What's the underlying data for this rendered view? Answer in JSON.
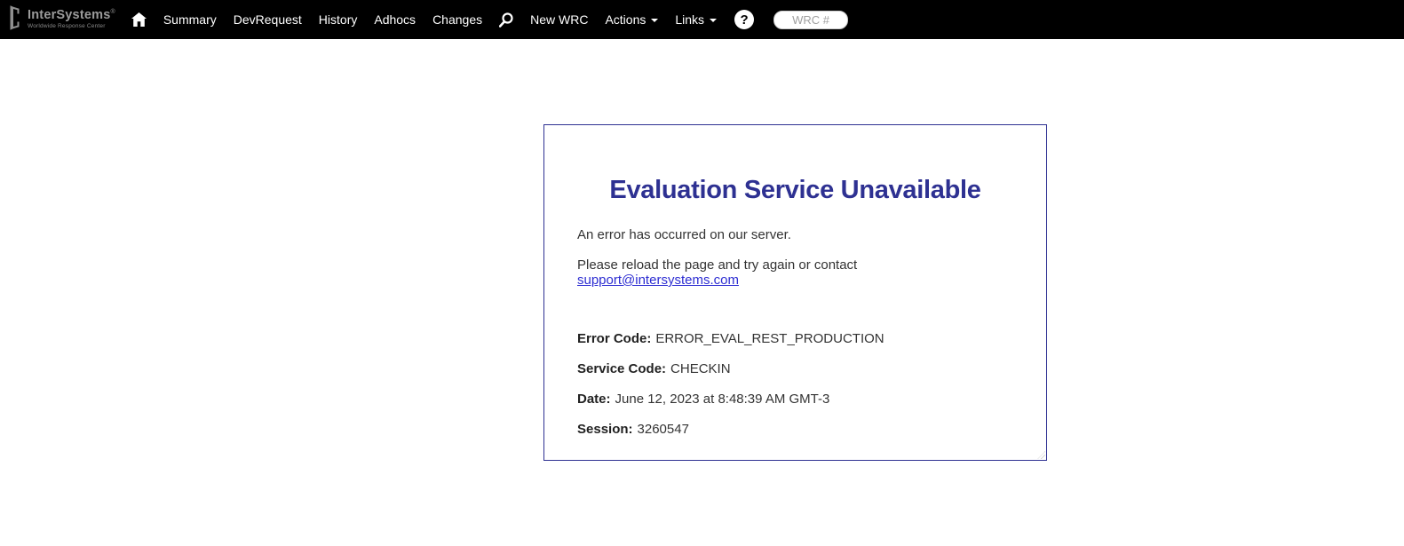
{
  "nav": {
    "brand": {
      "name": "InterSystems",
      "registered": "®",
      "tagline": "Worldwide Response Center"
    },
    "items": {
      "summary": "Summary",
      "devrequest": "DevRequest",
      "history": "History",
      "adhocs": "Adhocs",
      "changes": "Changes",
      "new_wrc": "New WRC",
      "actions": "Actions",
      "links": "Links"
    },
    "help_glyph": "?",
    "wrc_placeholder": "WRC #"
  },
  "error_panel": {
    "title": "Evaluation Service Unavailable",
    "message1": "An error has occurred on our server.",
    "message2_prefix": "Please reload the page and try again or contact ",
    "support_link": "support@intersystems.com",
    "details": [
      {
        "label": "Error Code:",
        "value": "ERROR_EVAL_REST_PRODUCTION"
      },
      {
        "label": "Service Code:",
        "value": "CHECKIN"
      },
      {
        "label": "Date:",
        "value": "June 12, 2023 at 8:48:39 AM GMT-3"
      },
      {
        "label": "Session:",
        "value": "3260547"
      }
    ]
  },
  "colors": {
    "nav_bg": "#000000",
    "accent": "#2e3192",
    "link": "#2d2dd2",
    "body_text": "#333333"
  }
}
